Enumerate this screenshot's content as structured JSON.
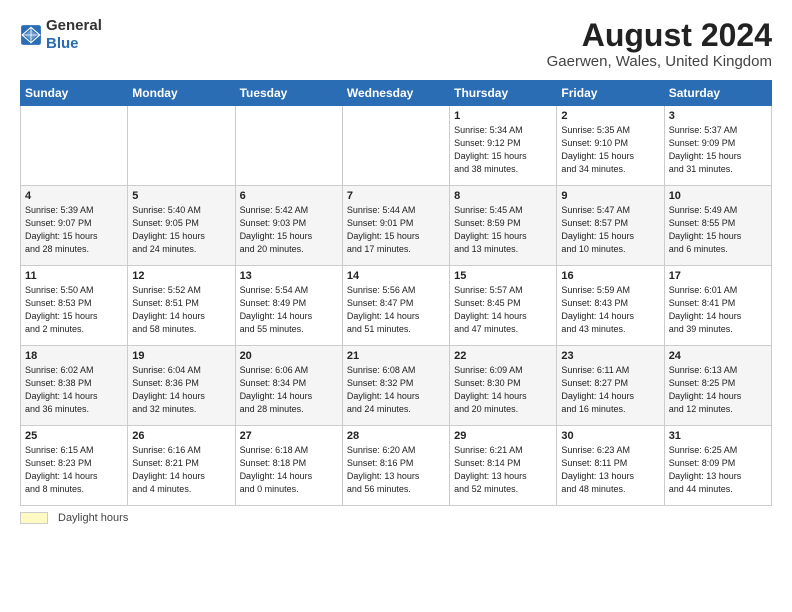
{
  "header": {
    "logo_general": "General",
    "logo_blue": "Blue",
    "title": "August 2024",
    "subtitle": "Gaerwen, Wales, United Kingdom"
  },
  "calendar": {
    "days_of_week": [
      "Sunday",
      "Monday",
      "Tuesday",
      "Wednesday",
      "Thursday",
      "Friday",
      "Saturday"
    ],
    "weeks": [
      [
        {
          "day": "",
          "info": ""
        },
        {
          "day": "",
          "info": ""
        },
        {
          "day": "",
          "info": ""
        },
        {
          "day": "",
          "info": ""
        },
        {
          "day": "1",
          "info": "Sunrise: 5:34 AM\nSunset: 9:12 PM\nDaylight: 15 hours\nand 38 minutes."
        },
        {
          "day": "2",
          "info": "Sunrise: 5:35 AM\nSunset: 9:10 PM\nDaylight: 15 hours\nand 34 minutes."
        },
        {
          "day": "3",
          "info": "Sunrise: 5:37 AM\nSunset: 9:09 PM\nDaylight: 15 hours\nand 31 minutes."
        }
      ],
      [
        {
          "day": "4",
          "info": "Sunrise: 5:39 AM\nSunset: 9:07 PM\nDaylight: 15 hours\nand 28 minutes."
        },
        {
          "day": "5",
          "info": "Sunrise: 5:40 AM\nSunset: 9:05 PM\nDaylight: 15 hours\nand 24 minutes."
        },
        {
          "day": "6",
          "info": "Sunrise: 5:42 AM\nSunset: 9:03 PM\nDaylight: 15 hours\nand 20 minutes."
        },
        {
          "day": "7",
          "info": "Sunrise: 5:44 AM\nSunset: 9:01 PM\nDaylight: 15 hours\nand 17 minutes."
        },
        {
          "day": "8",
          "info": "Sunrise: 5:45 AM\nSunset: 8:59 PM\nDaylight: 15 hours\nand 13 minutes."
        },
        {
          "day": "9",
          "info": "Sunrise: 5:47 AM\nSunset: 8:57 PM\nDaylight: 15 hours\nand 10 minutes."
        },
        {
          "day": "10",
          "info": "Sunrise: 5:49 AM\nSunset: 8:55 PM\nDaylight: 15 hours\nand 6 minutes."
        }
      ],
      [
        {
          "day": "11",
          "info": "Sunrise: 5:50 AM\nSunset: 8:53 PM\nDaylight: 15 hours\nand 2 minutes."
        },
        {
          "day": "12",
          "info": "Sunrise: 5:52 AM\nSunset: 8:51 PM\nDaylight: 14 hours\nand 58 minutes."
        },
        {
          "day": "13",
          "info": "Sunrise: 5:54 AM\nSunset: 8:49 PM\nDaylight: 14 hours\nand 55 minutes."
        },
        {
          "day": "14",
          "info": "Sunrise: 5:56 AM\nSunset: 8:47 PM\nDaylight: 14 hours\nand 51 minutes."
        },
        {
          "day": "15",
          "info": "Sunrise: 5:57 AM\nSunset: 8:45 PM\nDaylight: 14 hours\nand 47 minutes."
        },
        {
          "day": "16",
          "info": "Sunrise: 5:59 AM\nSunset: 8:43 PM\nDaylight: 14 hours\nand 43 minutes."
        },
        {
          "day": "17",
          "info": "Sunrise: 6:01 AM\nSunset: 8:41 PM\nDaylight: 14 hours\nand 39 minutes."
        }
      ],
      [
        {
          "day": "18",
          "info": "Sunrise: 6:02 AM\nSunset: 8:38 PM\nDaylight: 14 hours\nand 36 minutes."
        },
        {
          "day": "19",
          "info": "Sunrise: 6:04 AM\nSunset: 8:36 PM\nDaylight: 14 hours\nand 32 minutes."
        },
        {
          "day": "20",
          "info": "Sunrise: 6:06 AM\nSunset: 8:34 PM\nDaylight: 14 hours\nand 28 minutes."
        },
        {
          "day": "21",
          "info": "Sunrise: 6:08 AM\nSunset: 8:32 PM\nDaylight: 14 hours\nand 24 minutes."
        },
        {
          "day": "22",
          "info": "Sunrise: 6:09 AM\nSunset: 8:30 PM\nDaylight: 14 hours\nand 20 minutes."
        },
        {
          "day": "23",
          "info": "Sunrise: 6:11 AM\nSunset: 8:27 PM\nDaylight: 14 hours\nand 16 minutes."
        },
        {
          "day": "24",
          "info": "Sunrise: 6:13 AM\nSunset: 8:25 PM\nDaylight: 14 hours\nand 12 minutes."
        }
      ],
      [
        {
          "day": "25",
          "info": "Sunrise: 6:15 AM\nSunset: 8:23 PM\nDaylight: 14 hours\nand 8 minutes."
        },
        {
          "day": "26",
          "info": "Sunrise: 6:16 AM\nSunset: 8:21 PM\nDaylight: 14 hours\nand 4 minutes."
        },
        {
          "day": "27",
          "info": "Sunrise: 6:18 AM\nSunset: 8:18 PM\nDaylight: 14 hours\nand 0 minutes."
        },
        {
          "day": "28",
          "info": "Sunrise: 6:20 AM\nSunset: 8:16 PM\nDaylight: 13 hours\nand 56 minutes."
        },
        {
          "day": "29",
          "info": "Sunrise: 6:21 AM\nSunset: 8:14 PM\nDaylight: 13 hours\nand 52 minutes."
        },
        {
          "day": "30",
          "info": "Sunrise: 6:23 AM\nSunset: 8:11 PM\nDaylight: 13 hours\nand 48 minutes."
        },
        {
          "day": "31",
          "info": "Sunrise: 6:25 AM\nSunset: 8:09 PM\nDaylight: 13 hours\nand 44 minutes."
        }
      ]
    ]
  },
  "footer": {
    "legend_label": "Daylight hours"
  }
}
